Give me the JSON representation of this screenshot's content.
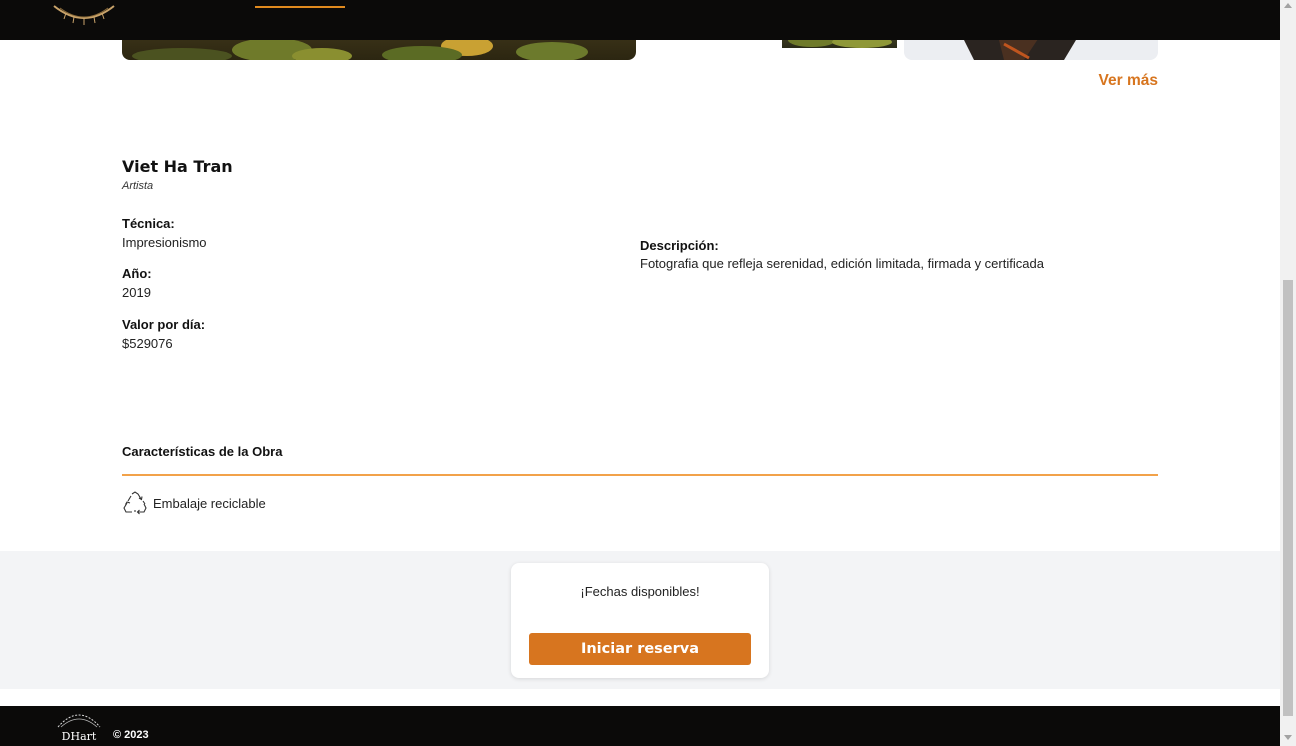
{
  "header": {
    "logo_icon": "dhart-logo-icon"
  },
  "gallery": {
    "thumb_caption": "",
    "more_link": "Ver más"
  },
  "artist": {
    "name": "Viet Ha Tran",
    "role": "Artista"
  },
  "details": {
    "technique_label": "Técnica:",
    "technique_value": "Impresionismo",
    "year_label": "Año:",
    "year_value": "2019",
    "price_label": "Valor por día:",
    "price_value": "$529076",
    "description_label": "Descripción:",
    "description_value": "Fotografia que refleja serenidad, edición limitada, firmada y certificada"
  },
  "features": {
    "title": "Características de la Obra",
    "items": [
      {
        "icon": "recycle-icon",
        "label": "Embalaje reciclable"
      }
    ]
  },
  "availability": {
    "text": "¡Fechas disponibles!",
    "button_label": "Iniciar reserva"
  },
  "footer": {
    "logo_text": "DHart",
    "copyright": "© 2023"
  },
  "colors": {
    "accent": "#d7751f",
    "divider": "#f2a24a",
    "header_bg": "#0b0a09",
    "band_bg": "#f3f4f6"
  }
}
